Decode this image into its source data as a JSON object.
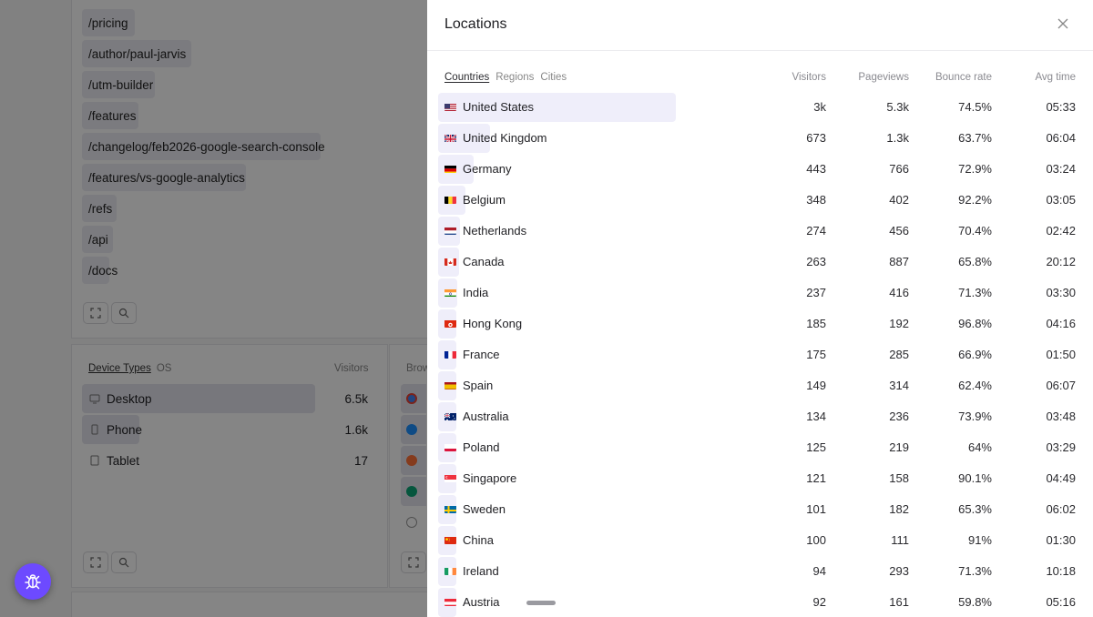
{
  "background": {
    "pages": [
      "/pricing",
      "/author/paul-jarvis",
      "/utm-builder",
      "/features",
      "/changelog/feb2026-google-search-console",
      "/features/vs-google-analytics",
      "/refs",
      "/api",
      "/docs"
    ],
    "device_tabs": [
      "Device Types",
      "OS"
    ],
    "device_col": "Visitors",
    "browser_col_partial": "Brow",
    "devices": [
      {
        "label": "Desktop",
        "value": "6.5k",
        "icon": "monitor-icon"
      },
      {
        "label": "Phone",
        "value": "1.6k",
        "icon": "phone-icon"
      },
      {
        "label": "Tablet",
        "value": "17",
        "icon": "tablet-icon"
      }
    ]
  },
  "panel": {
    "title": "Locations",
    "tabs": [
      "Countries",
      "Regions",
      "Cities"
    ],
    "columns": {
      "visitors": "Visitors",
      "pageviews": "Pageviews",
      "bounce": "Bounce rate",
      "avg": "Avg time"
    },
    "rows": [
      {
        "name": "United States",
        "flag": "us",
        "visitors": "3k",
        "pageviews": "5.3k",
        "bounce": "74.5%",
        "avg": "05:33",
        "share": 1.0
      },
      {
        "name": "United Kingdom",
        "flag": "gb",
        "visitors": "673",
        "pageviews": "1.3k",
        "bounce": "63.7%",
        "avg": "06:04",
        "share": 0.22
      },
      {
        "name": "Germany",
        "flag": "de",
        "visitors": "443",
        "pageviews": "766",
        "bounce": "72.9%",
        "avg": "03:24",
        "share": 0.148
      },
      {
        "name": "Belgium",
        "flag": "be",
        "visitors": "348",
        "pageviews": "402",
        "bounce": "92.2%",
        "avg": "03:05",
        "share": 0.116
      },
      {
        "name": "Netherlands",
        "flag": "nl",
        "visitors": "274",
        "pageviews": "456",
        "bounce": "70.4%",
        "avg": "02:42",
        "share": 0.091
      },
      {
        "name": "Canada",
        "flag": "ca",
        "visitors": "263",
        "pageviews": "887",
        "bounce": "65.8%",
        "avg": "20:12",
        "share": 0.088
      },
      {
        "name": "India",
        "flag": "in",
        "visitors": "237",
        "pageviews": "416",
        "bounce": "71.3%",
        "avg": "03:30",
        "share": 0.079
      },
      {
        "name": "Hong Kong",
        "flag": "hk",
        "visitors": "185",
        "pageviews": "192",
        "bounce": "96.8%",
        "avg": "04:16",
        "share": 0.062
      },
      {
        "name": "France",
        "flag": "fr",
        "visitors": "175",
        "pageviews": "285",
        "bounce": "66.9%",
        "avg": "01:50",
        "share": 0.058
      },
      {
        "name": "Spain",
        "flag": "es",
        "visitors": "149",
        "pageviews": "314",
        "bounce": "62.4%",
        "avg": "06:07",
        "share": 0.05
      },
      {
        "name": "Australia",
        "flag": "au",
        "visitors": "134",
        "pageviews": "236",
        "bounce": "73.9%",
        "avg": "03:48",
        "share": 0.045
      },
      {
        "name": "Poland",
        "flag": "pl",
        "visitors": "125",
        "pageviews": "219",
        "bounce": "64%",
        "avg": "03:29",
        "share": 0.042
      },
      {
        "name": "Singapore",
        "flag": "sg",
        "visitors": "121",
        "pageviews": "158",
        "bounce": "90.1%",
        "avg": "04:49",
        "share": 0.04
      },
      {
        "name": "Sweden",
        "flag": "se",
        "visitors": "101",
        "pageviews": "182",
        "bounce": "65.3%",
        "avg": "06:02",
        "share": 0.034
      },
      {
        "name": "China",
        "flag": "cn",
        "visitors": "100",
        "pageviews": "111",
        "bounce": "91%",
        "avg": "01:30",
        "share": 0.033
      },
      {
        "name": "Ireland",
        "flag": "ie",
        "visitors": "94",
        "pageviews": "293",
        "bounce": "71.3%",
        "avg": "10:18",
        "share": 0.031
      },
      {
        "name": "Austria",
        "flag": "at",
        "visitors": "92",
        "pageviews": "161",
        "bounce": "59.8%",
        "avg": "05:16",
        "share": 0.031
      }
    ]
  },
  "colors": {
    "accent": "#6d4aff",
    "bar": "#efeefa"
  },
  "fab_icon": "bug-icon"
}
